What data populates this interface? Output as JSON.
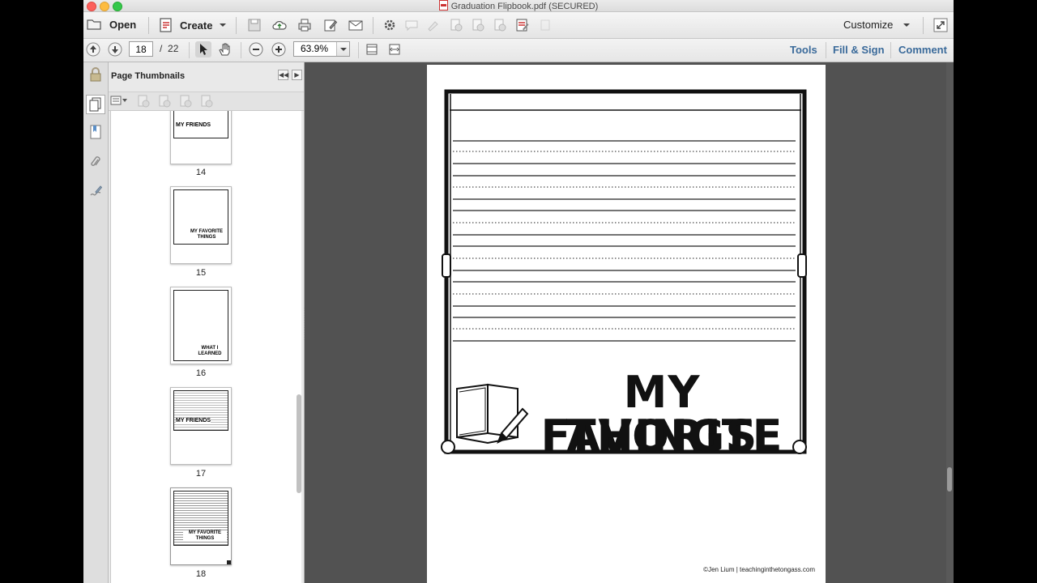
{
  "window": {
    "title": "Graduation Flipbook.pdf (SECURED)"
  },
  "toolbar": {
    "open_label": "Open",
    "create_label": "Create",
    "customize_label": "Customize"
  },
  "nav": {
    "current_page": "18",
    "page_separator": "/",
    "total_pages": "22",
    "zoom": "63.9%"
  },
  "panes": {
    "tools_label": "Tools",
    "fill_sign_label": "Fill & Sign",
    "comment_label": "Comment"
  },
  "sidebar": {
    "panel_title": "Page Thumbnails",
    "thumbnails": [
      {
        "page": "14",
        "caption": "MY FRIENDS"
      },
      {
        "page": "15",
        "caption": "MY FAVORITE THINGS"
      },
      {
        "page": "16",
        "caption": "WHAT I LEARNED"
      },
      {
        "page": "17",
        "caption": "MY FRIENDS"
      },
      {
        "page": "18",
        "caption": "MY FAVORITE THINGS"
      }
    ]
  },
  "document": {
    "heading_line1": "MY FAVORITE",
    "heading_line2": "THINGS",
    "footer": "©Jen Lium | teachinginthetongass.com"
  }
}
